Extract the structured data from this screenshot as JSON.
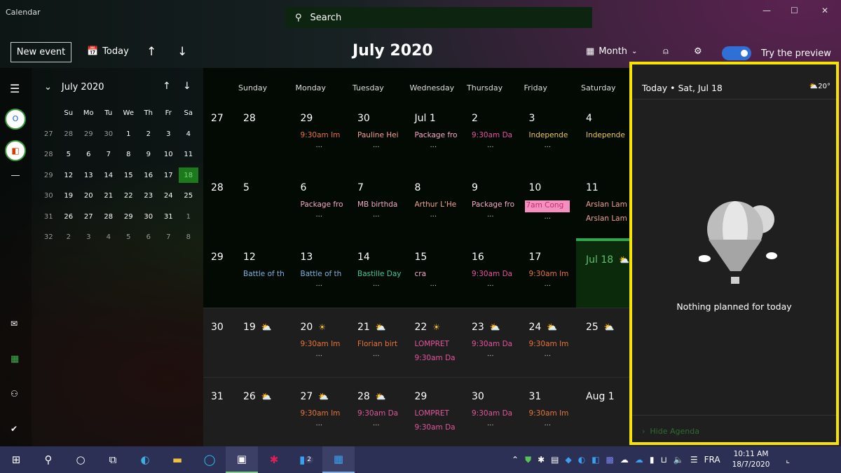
{
  "app": {
    "title": "Calendar",
    "window_controls": [
      "—",
      "☐",
      "✕"
    ]
  },
  "search": {
    "placeholder": "Search"
  },
  "toolbar": {
    "new_event": "New event",
    "today": "Today",
    "month_title": "July 2020",
    "view": "Month",
    "preview_label": "Try the preview",
    "preview_on": true
  },
  "mini_calendar": {
    "title": "July 2020",
    "weekdays": [
      "Su",
      "Mo",
      "Tu",
      "We",
      "Th",
      "Fr",
      "Sa"
    ],
    "weeks": [
      [
        "27",
        "28",
        "29",
        "30",
        "1",
        "2",
        "3",
        "4"
      ],
      [
        "28",
        "5",
        "6",
        "7",
        "8",
        "9",
        "10",
        "11"
      ],
      [
        "29",
        "12",
        "13",
        "14",
        "15",
        "16",
        "17",
        "18"
      ],
      [
        "30",
        "19",
        "20",
        "21",
        "22",
        "23",
        "24",
        "25"
      ],
      [
        "31",
        "26",
        "27",
        "28",
        "29",
        "30",
        "31",
        "1"
      ],
      [
        "32",
        "2",
        "3",
        "4",
        "5",
        "6",
        "7",
        "8"
      ]
    ],
    "selected": "18"
  },
  "day_headers": [
    "Sunday",
    "Monday",
    "Tuesday",
    "Wednesday",
    "Thursday",
    "Friday",
    "Saturday"
  ],
  "colors": {
    "orange": "#e8743b",
    "pink": "#e3559e",
    "yellow": "#e8c95a",
    "salmon": "#f0a08c",
    "blue": "#7fb0e0",
    "teal": "#3cc8a0",
    "lightpink": "#f4a8c8",
    "accent": "#2fa84f",
    "highlight": "#f5e400"
  },
  "weeks": [
    {
      "num": "27",
      "light": false,
      "days": [
        {
          "d": "28",
          "events": [],
          "more": false
        },
        {
          "d": "29",
          "events": [
            {
              "t": "9:30am  Im",
              "c": "orange"
            }
          ],
          "more": true
        },
        {
          "d": "30",
          "events": [
            {
              "t": "Pauline Hei",
              "c": "salmon"
            }
          ],
          "more": true
        },
        {
          "d": "Jul 1",
          "events": [
            {
              "t": "Package fro",
              "c": "lightpink"
            }
          ],
          "more": true
        },
        {
          "d": "2",
          "events": [
            {
              "t": "9:30am  Da",
              "c": "pink"
            }
          ],
          "more": true
        },
        {
          "d": "3",
          "events": [
            {
              "t": "Independe",
              "c": "yellow"
            }
          ],
          "more": true
        },
        {
          "d": "4",
          "events": [
            {
              "t": "Independe",
              "c": "yellow"
            }
          ],
          "more": false
        }
      ]
    },
    {
      "num": "28",
      "light": false,
      "days": [
        {
          "d": "5",
          "events": [],
          "more": false
        },
        {
          "d": "6",
          "events": [
            {
              "t": "Package fro",
              "c": "lightpink"
            }
          ],
          "more": true
        },
        {
          "d": "7",
          "events": [
            {
              "t": "MB birthda",
              "c": "lightpink"
            }
          ],
          "more": true
        },
        {
          "d": "8",
          "events": [
            {
              "t": "Arthur L'He",
              "c": "salmon"
            }
          ],
          "more": true
        },
        {
          "d": "9",
          "events": [
            {
              "t": "Package fro",
              "c": "lightpink"
            }
          ],
          "more": true
        },
        {
          "d": "10",
          "events": [
            {
              "t": "7am  Cong",
              "c": "badge"
            }
          ],
          "more": true
        },
        {
          "d": "11",
          "events": [
            {
              "t": "Arslan Lam",
              "c": "salmon"
            },
            {
              "t": "Arslan Lam",
              "c": "salmon"
            }
          ],
          "more": false
        }
      ]
    },
    {
      "num": "29",
      "light": false,
      "days": [
        {
          "d": "12",
          "events": [
            {
              "t": "Battle of th",
              "c": "blue"
            }
          ],
          "more": false
        },
        {
          "d": "13",
          "events": [
            {
              "t": "Battle of th",
              "c": "blue"
            }
          ],
          "more": true
        },
        {
          "d": "14",
          "events": [
            {
              "t": "Bastille Day",
              "c": "teal"
            }
          ],
          "more": true
        },
        {
          "d": "15",
          "events": [
            {
              "t": "cra",
              "c": "lightpink"
            }
          ],
          "more": true
        },
        {
          "d": "16",
          "events": [
            {
              "t": "9:30am  Da",
              "c": "pink"
            }
          ],
          "more": true
        },
        {
          "d": "17",
          "events": [
            {
              "t": "9:30am  Im",
              "c": "orange"
            }
          ],
          "more": true
        },
        {
          "d": "Jul 18",
          "weather": "partly-cloudy",
          "today": true,
          "events": [],
          "more": false
        }
      ]
    },
    {
      "num": "30",
      "light": true,
      "days": [
        {
          "d": "19",
          "weather": "partly-cloudy",
          "events": [],
          "more": false
        },
        {
          "d": "20",
          "weather": "sunny",
          "events": [
            {
              "t": "9:30am  Im",
              "c": "orange"
            }
          ],
          "more": true
        },
        {
          "d": "21",
          "weather": "partly-cloudy",
          "events": [
            {
              "t": "Florian birt",
              "c": "orange"
            }
          ],
          "more": true
        },
        {
          "d": "22",
          "weather": "sunny",
          "events": [
            {
              "t": "LOMPRET",
              "c": "pink"
            },
            {
              "t": "9:30am  Da",
              "c": "pink"
            }
          ],
          "more": false
        },
        {
          "d": "23",
          "weather": "partly-cloudy",
          "events": [
            {
              "t": "9:30am  Da",
              "c": "pink"
            }
          ],
          "more": true
        },
        {
          "d": "24",
          "weather": "partly-cloudy",
          "events": [
            {
              "t": "9:30am  Im",
              "c": "orange"
            }
          ],
          "more": true
        },
        {
          "d": "25",
          "weather": "partly-cloudy",
          "events": [],
          "more": false
        }
      ]
    },
    {
      "num": "31",
      "light": true,
      "days": [
        {
          "d": "26",
          "weather": "partly-cloudy",
          "events": [],
          "more": false
        },
        {
          "d": "27",
          "weather": "partly-cloudy",
          "events": [
            {
              "t": "9:30am  Im",
              "c": "orange"
            }
          ],
          "more": true
        },
        {
          "d": "28",
          "weather": "partly-cloudy",
          "events": [
            {
              "t": "9:30am  Da",
              "c": "pink"
            }
          ],
          "more": true
        },
        {
          "d": "29",
          "events": [
            {
              "t": "LOMPRET",
              "c": "pink"
            },
            {
              "t": "9:30am  Da",
              "c": "pink"
            }
          ],
          "more": false
        },
        {
          "d": "30",
          "events": [
            {
              "t": "9:30am  Da",
              "c": "pink"
            }
          ],
          "more": true
        },
        {
          "d": "31",
          "events": [
            {
              "t": "9:30am  Im",
              "c": "orange"
            }
          ],
          "more": true
        },
        {
          "d": "Aug 1",
          "events": [],
          "more": false
        }
      ]
    }
  ],
  "agenda": {
    "title": "Today • Sat, Jul 18",
    "temp": "20°",
    "empty": "Nothing planned for today",
    "hide": "Hide Agenda"
  },
  "taskbar": {
    "lang": "FRA",
    "time": "10:11 AM",
    "date": "18/7/2020",
    "notifications": "2"
  }
}
